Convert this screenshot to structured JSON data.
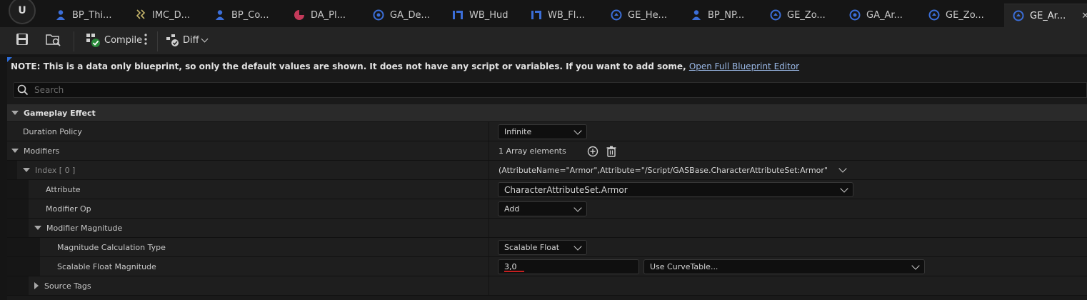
{
  "tabs": [
    {
      "label": "BP_Thi...",
      "icon": "blueprint-actor-icon",
      "color": "#3b6ed8"
    },
    {
      "label": "IMC_D...",
      "icon": "input-mapping-icon",
      "color": "#c4b46a"
    },
    {
      "label": "BP_Co...",
      "icon": "blueprint-actor-icon",
      "color": "#3b6ed8"
    },
    {
      "label": "DA_Pl...",
      "icon": "data-asset-icon",
      "color": "#c43a5a"
    },
    {
      "label": "GA_De...",
      "icon": "gameplay-ability-icon",
      "color": "#3b6ed8"
    },
    {
      "label": "WB_Hud",
      "icon": "widget-blueprint-icon",
      "color": "#3b6ed8"
    },
    {
      "label": "WB_Fl...",
      "icon": "widget-blueprint-icon",
      "color": "#3b6ed8"
    },
    {
      "label": "GE_He...",
      "icon": "gameplay-effect-icon",
      "color": "#3b6ed8"
    },
    {
      "label": "BP_NP...",
      "icon": "blueprint-actor-icon",
      "color": "#3b6ed8"
    },
    {
      "label": "GE_Zo...",
      "icon": "gameplay-effect-icon",
      "color": "#3b6ed8"
    },
    {
      "label": "GA_Ar...",
      "icon": "gameplay-ability-icon",
      "color": "#3b6ed8"
    },
    {
      "label": "GE_Zo...",
      "icon": "gameplay-effect-icon",
      "color": "#3b6ed8"
    },
    {
      "label": "GE_Ar...",
      "icon": "gameplay-effect-icon",
      "color": "#3b6ed8",
      "active": true
    }
  ],
  "toolbar": {
    "compile_label": "Compile",
    "diff_label": "Diff"
  },
  "notice": {
    "text": "NOTE: This is a data only blueprint, so only the default values are shown.  It does not have any script or variables.  If you want to add some,",
    "link": "Open Full Blueprint Editor"
  },
  "search": {
    "placeholder": "Search"
  },
  "details": {
    "category": "Gameplay Effect",
    "duration_policy": {
      "label": "Duration Policy",
      "value": "Infinite"
    },
    "modifiers": {
      "label": "Modifiers",
      "value": "1 Array elements"
    },
    "index0": {
      "label": "Index [ 0 ]",
      "value": "(AttributeName=\"Armor\",Attribute=\"/Script/GASBase.CharacterAttributeSet:Armor\",Attribute"
    },
    "attribute": {
      "label": "Attribute",
      "value": "CharacterAttributeSet.Armor"
    },
    "modifier_op": {
      "label": "Modifier Op",
      "value": "Add"
    },
    "modifier_magnitude": {
      "label": "Modifier Magnitude"
    },
    "magnitude_calc_type": {
      "label": "Magnitude Calculation Type",
      "value": "Scalable Float"
    },
    "scalable_float_magnitude": {
      "label": "Scalable Float Magnitude",
      "value": "3,0",
      "curve_table": "Use CurveTable..."
    },
    "source_tags": {
      "label": "Source Tags"
    }
  }
}
